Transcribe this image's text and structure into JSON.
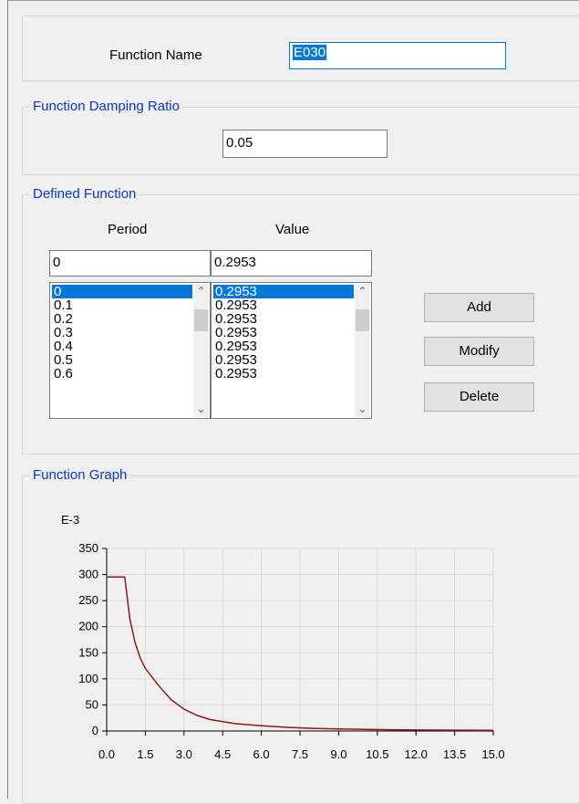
{
  "function_name": {
    "label": "Function Name",
    "value": "E030"
  },
  "damping": {
    "title": "Function Damping Ratio",
    "value": "0.05"
  },
  "defined_function": {
    "title": "Defined Function",
    "period_header": "Period",
    "value_header": "Value",
    "period_input": "0",
    "value_input": "0.2953",
    "periods": [
      "0",
      "0.1",
      "0.2",
      "0.3",
      "0.4",
      "0.5",
      "0.6"
    ],
    "values": [
      "0.2953",
      "0.2953",
      "0.2953",
      "0.2953",
      "0.2953",
      "0.2953",
      "0.2953"
    ],
    "selected_index": 0,
    "buttons": {
      "add": "Add",
      "modify": "Modify",
      "delete": "Delete"
    },
    "scroll_up_icon": "chevron-up-icon",
    "scroll_down_icon": "chevron-down-icon"
  },
  "graph": {
    "title": "Function Graph",
    "line_color": "#8b1a1a"
  },
  "chart_data": {
    "type": "line",
    "scale_label": "E-3",
    "x": [
      0,
      0.4,
      0.7,
      0.9,
      1.1,
      1.3,
      1.5,
      2.0,
      2.5,
      3.0,
      3.5,
      4.0,
      5.0,
      6.0,
      7.0,
      8.0,
      9.0,
      10.0,
      11.0,
      12.0,
      13.0,
      14.0,
      15.0
    ],
    "y": [
      295.3,
      295.3,
      295.3,
      215,
      170,
      140,
      120,
      88,
      60,
      42,
      30,
      22,
      14,
      10,
      7,
      5,
      4,
      3,
      2.5,
      2,
      1.7,
      1.5,
      1.3
    ],
    "xlim": [
      0,
      15
    ],
    "ylim": [
      0,
      350
    ],
    "x_ticks": [
      "0.0",
      "1.5",
      "3.0",
      "4.5",
      "6.0",
      "7.5",
      "9.0",
      "10.5",
      "12.0",
      "13.5",
      "15.0"
    ],
    "y_ticks": [
      "0",
      "50",
      "100",
      "150",
      "200",
      "250",
      "300",
      "350"
    ],
    "grid": true,
    "line_color": "#8b1a1a"
  }
}
